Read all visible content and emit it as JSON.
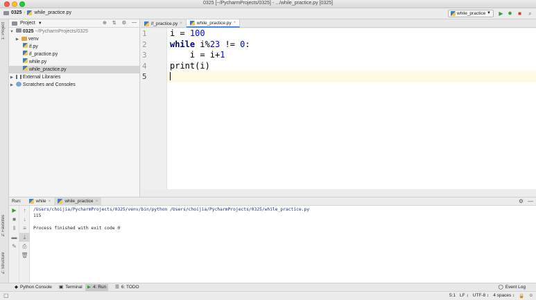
{
  "window": {
    "title": "0325 [~/PycharmProjects/0325] - .../while_practice.py [0325]"
  },
  "nav": {
    "project": "0325",
    "file": "while_practice.py",
    "run_config": "while_practice"
  },
  "sidebar_tabs": {
    "project": "1: Project",
    "favorites": "2: Favorites",
    "structure": "Z: Structure"
  },
  "project_panel": {
    "title": "Project",
    "root_name": "0325",
    "root_path": "~/PycharmProjects/0325",
    "items": [
      "venv",
      "if.py",
      "if_practice.py",
      "while.py",
      "while_practice.py"
    ],
    "external": "External Libraries",
    "scratches": "Scratches and Consoles"
  },
  "editor": {
    "tabs": [
      {
        "label": "if_practice.py",
        "active": false
      },
      {
        "label": "while_practice.py",
        "active": true
      }
    ],
    "line_numbers": [
      "1",
      "2",
      "3",
      "4",
      "5"
    ],
    "code": {
      "l1_pre": "i = ",
      "l1_num": "100",
      "l2_kw": "while",
      "l2_mid": " i%",
      "l2_num1": "23",
      "l2_op": " != ",
      "l2_num2": "0",
      "l2_end": ":",
      "l3_pre": "    i = i+",
      "l3_num": "1",
      "l4": "print(i)"
    }
  },
  "run": {
    "label": "Run:",
    "tabs": [
      "while",
      "while_practice"
    ],
    "console": [
      "/Users/choijia/PycharmProjects/0325/venv/bin/python /Users/choijia/PycharmProjects/0325/while_practice.py",
      "115",
      "",
      "Process finished with exit code 0"
    ]
  },
  "bottom_tabs": {
    "python_console": "Python Console",
    "terminal": "Terminal",
    "run": "4: Run",
    "todo": "6: TODO",
    "event_log": "Event Log"
  },
  "status": {
    "position": "5:1",
    "line_sep": "LF ↕",
    "encoding": "UTF-8 ↕",
    "indent": "4 spaces ↕"
  }
}
